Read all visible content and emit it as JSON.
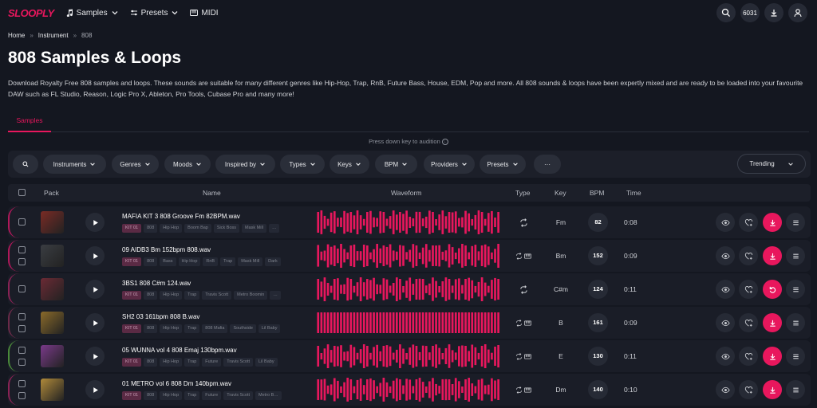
{
  "nav": {
    "logo": "SLOOPLY",
    "items": [
      "Samples",
      "Presets",
      "MIDI"
    ],
    "credits": "6031"
  },
  "breadcrumb": [
    "Home",
    "Instrument",
    "808"
  ],
  "page_title": "808 Samples & Loops",
  "description": "Download Royalty Free 808 samples and loops. These sounds are suitable for many different genres like Hip-Hop, Trap, RnB, Future Bass, House, EDM, Pop and more. All 808 sounds & loops have been expertly mixed and are ready to be loaded into your favourite DAW such as FL Studio, Reason, Logic Pro X, Ableton, Pro Tools, Cubase Pro and many more!",
  "tab": "Samples",
  "hint": "Press down key to audition",
  "filters": [
    "Instruments",
    "Genres",
    "Moods",
    "Inspired by",
    "Types",
    "Keys",
    "BPM",
    "Providers",
    "Presets",
    "···"
  ],
  "sort": "Trending",
  "columns": {
    "pack": "Pack",
    "name": "Name",
    "waveform": "Waveform",
    "type": "Type",
    "key": "Key",
    "bpm": "BPM",
    "time": "Time"
  },
  "accent": "#e8175d",
  "rows": [
    {
      "name": "MAFIA KIT 3 808 Groove Fm 82BPM.wav",
      "tags": [
        "KIT 01",
        "808",
        "Hip Hop",
        "Boom Bap",
        "Sick Boss",
        "Mask Mill",
        "…"
      ],
      "key": "Fm",
      "bpm": "82",
      "time": "0:08",
      "edge": "#b0185a",
      "art": "#7a2b25",
      "type": "loop",
      "action": "download"
    },
    {
      "name": "09 AIDB3 Bm 152bpm 808.wav",
      "tags": [
        "KIT 01",
        "808",
        "Bass",
        "Hip Hop",
        "RnB",
        "Trap",
        "Mask Mill",
        "Dark"
      ],
      "key": "Bm",
      "bpm": "152",
      "time": "0:09",
      "edge": "#b0185a",
      "art": "#3a3d42",
      "type": "loop-midi",
      "action": "download"
    },
    {
      "name": "3BS1 808 C#m 124.wav",
      "tags": [
        "KIT 01",
        "808",
        "Hip Hop",
        "Trap",
        "Travis Scott",
        "Metro Boomin",
        "…"
      ],
      "key": "C#m",
      "bpm": "124",
      "time": "0:11",
      "edge": "#8a2255",
      "art": "#6b2a35",
      "type": "loop",
      "action": "restore"
    },
    {
      "name": "SH2 03 161bpm 808 B.wav",
      "tags": [
        "KIT 01",
        "808",
        "Hip Hop",
        "Trap",
        "808 Mafia",
        "Southside",
        "Lil Baby"
      ],
      "key": "B",
      "bpm": "161",
      "time": "0:09",
      "edge": "#6a2a48",
      "art": "#8a6a2a",
      "type": "loop-midi",
      "action": "download"
    },
    {
      "name": "05 WUNNA vol 4 808 Emaj 130bpm.wav",
      "tags": [
        "KIT 01",
        "808",
        "Hip Hop",
        "Trap",
        "Future",
        "Travis Scott",
        "Lil Baby"
      ],
      "key": "E",
      "bpm": "130",
      "time": "0:11",
      "edge": "#4a8a3a",
      "art": "#7a3a8a",
      "type": "loop-midi",
      "action": "download"
    },
    {
      "name": "01 METRO vol 6 808 Dm 140bpm.wav",
      "tags": [
        "KIT 01",
        "808",
        "Hip Hop",
        "Trap",
        "Future",
        "Travis Scott",
        "Metro B…"
      ],
      "key": "Dm",
      "bpm": "140",
      "time": "0:10",
      "edge": "#8a2255",
      "art": "#b08a3a",
      "type": "loop-midi",
      "action": "download"
    }
  ]
}
